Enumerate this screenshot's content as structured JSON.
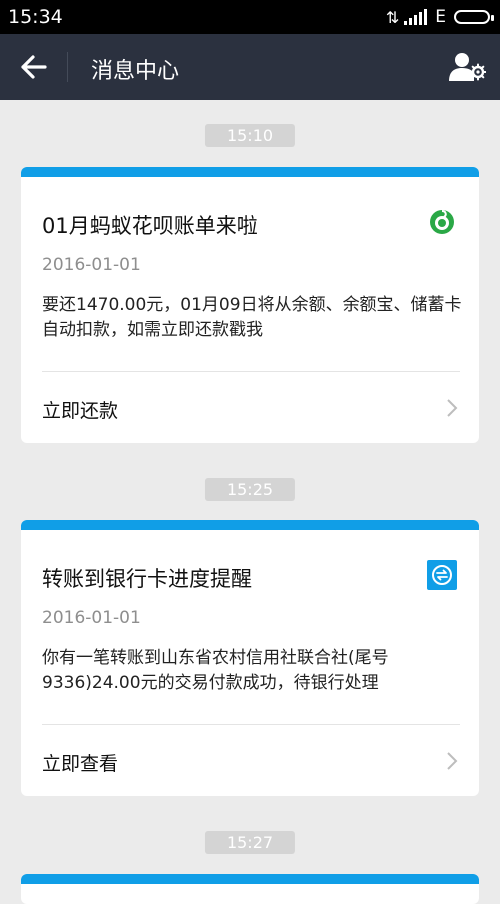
{
  "status_bar": {
    "time": "15:34",
    "network": "E"
  },
  "header": {
    "title": "消息中心"
  },
  "messages": [
    {
      "time": "15:10",
      "title": "01月蚂蚁花呗账单来啦",
      "date": "2016-01-01",
      "body": "要还1470.00元，01月09日将从余额、余额宝、储蓄卡自动扣款，如需立即还款戳我",
      "action": "立即还款",
      "icon": "ant-huabei-icon"
    },
    {
      "time": "15:25",
      "title": "转账到银行卡进度提醒",
      "date": "2016-01-01",
      "body": "你有一笔转账到山东省农村信用社联合社(尾号9336)24.00元的交易付款成功，待银行处理",
      "action": "立即查看",
      "icon": "transfer-icon"
    },
    {
      "time": "15:27"
    }
  ],
  "colors": {
    "accent": "#109ee7",
    "header": "#2b313f",
    "background": "#ebebeb",
    "huabei_green": "#27ae60"
  }
}
